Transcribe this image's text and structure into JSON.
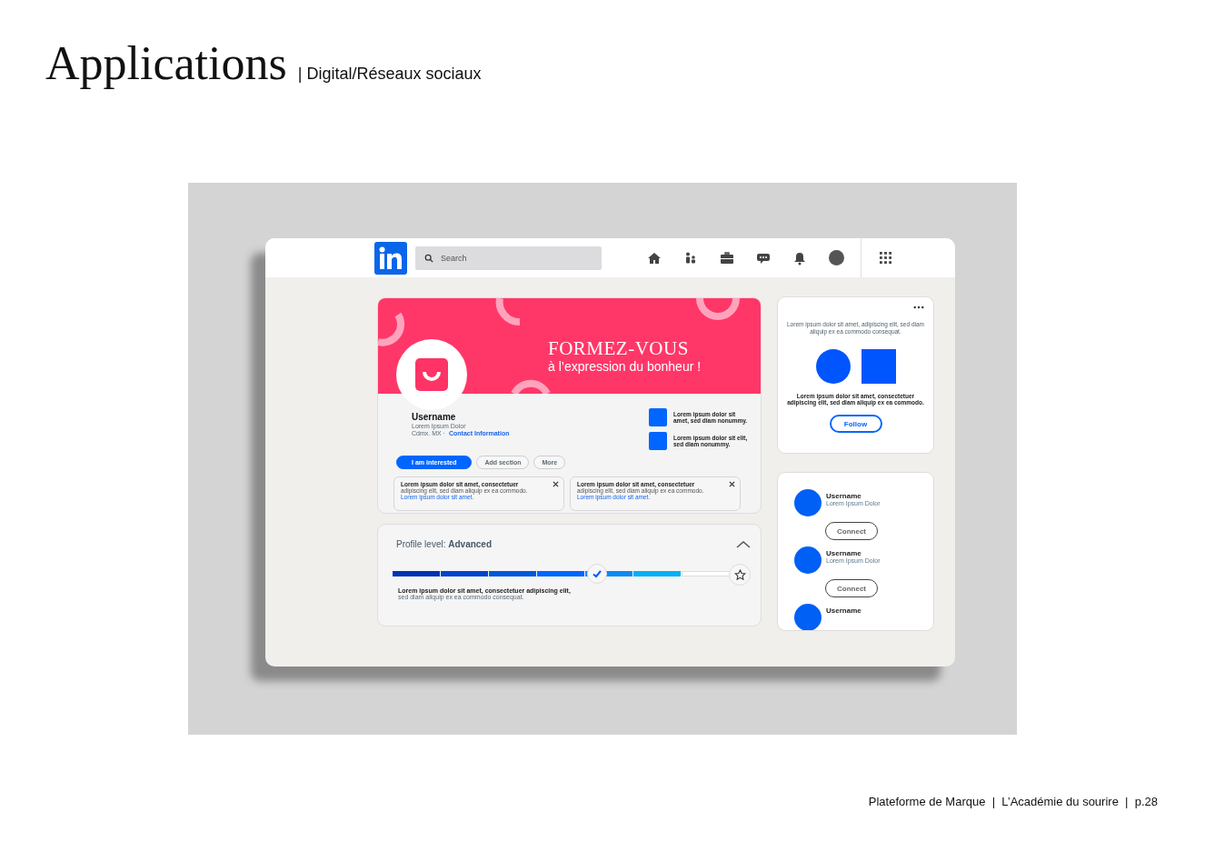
{
  "heading": {
    "title": "Applications",
    "subtitle": "| Digital/Réseaux sociaux"
  },
  "mockup": {
    "nav": {
      "search": {
        "placeholder": "Search"
      }
    },
    "banner": {
      "headline": "FORMEZ-VOUS",
      "tagline": "à l’expression du bonheur !"
    },
    "profile": {
      "name": "Username",
      "headline": "Lorem Ipsum Dolor",
      "location": "Cdmx. MX ·",
      "contact_link": "Contact Information"
    },
    "highlights": [
      {
        "text": "Lorem ipsum dolor sit amet, sed diam nonummy."
      },
      {
        "text": "Lorem ipsum dolor sit elit, sed diam nonummy."
      }
    ],
    "actions": [
      {
        "label": "I am interested",
        "kind": "primary"
      },
      {
        "label": "Add section",
        "kind": "outline"
      },
      {
        "label": "More",
        "kind": "outline"
      }
    ],
    "notices": [
      {
        "title": "Lorem ipsum dolor sit amet, consectetuer",
        "body": "adipiscing elit, sed diam aliquip ex ea commodo.",
        "link": "Lorem ipsum dolor sit amet."
      },
      {
        "title": "Lorem ipsum dolor sit amet, consectetuer",
        "body": "adipiscing elit, sed diam aliquip ex ea commodo.",
        "link": "Lorem ipsum dolor sit amet."
      }
    ],
    "profile_level": {
      "label": "Profile level:",
      "value": "Advanced",
      "level": 0.57,
      "description_bold": "Lorem ipsum dolor sit amet, consectetuer adipiscing elit,",
      "description": "sed diam aliquip ex ea commodo consequat."
    },
    "ad_card": {
      "top_text": "Lorem ipsum dolor sit amet, adipiscing elit, sed diam aliquip ex ea commodo consequat.",
      "bottom_text": "Lorem ipsum dolor sit amet, consectetuer adipiscing elit, sed diam aliquip ex ea commodo.",
      "button": "Follow"
    },
    "suggestions": [
      {
        "name": "Username",
        "headline": "Lorem Ipsum Dolor",
        "button": "Connect"
      },
      {
        "name": "Username",
        "headline": "Lorem Ipsum Dolor",
        "button": "Connect"
      },
      {
        "name": "Username"
      }
    ]
  },
  "footer": {
    "text": "Plateforme de Marque  |  L’Académie du sourire  |  p.28"
  }
}
